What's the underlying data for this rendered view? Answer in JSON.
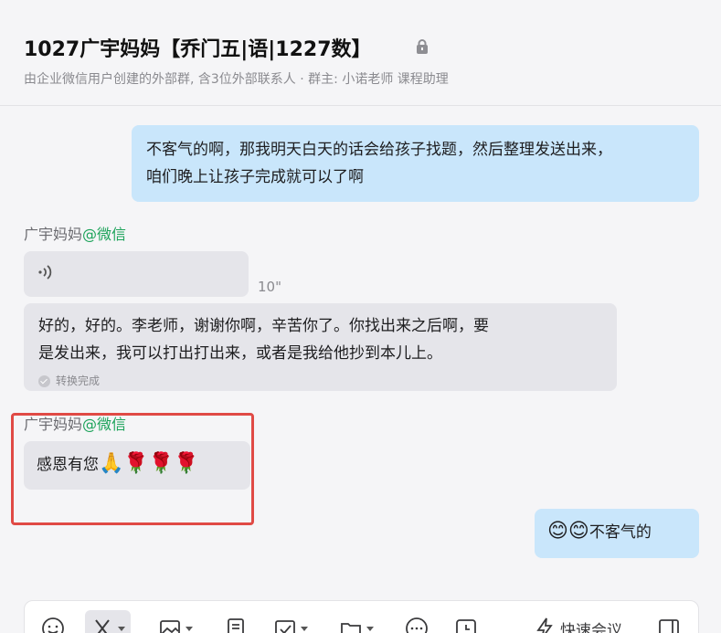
{
  "header": {
    "title": "1027广宇妈妈【乔门五|语|1227数】",
    "subtitle": "由企业微信用户创建的外部群, 含3位外部联系人 · 群主: 小诺老师 课程助理"
  },
  "messages": [
    {
      "side": "me",
      "text_line1": "不客气的啊，那我明天白天的话会给孩子找题，然后整理发送出来，",
      "text_line2": "咱们晚上让孩子完成就可以了啊"
    },
    {
      "side": "them",
      "sender_name": "广宇妈妈",
      "sender_source": "@微信",
      "type": "voice",
      "duration": "10\"",
      "transcript_line1": "好的，好的。李老师，谢谢你啊，辛苦你了。你找出来之后啊，要",
      "transcript_line2": "是发出来，我可以打出打出来，或者是我给他抄到本儿上。",
      "convert_status": "转换完成"
    },
    {
      "side": "them",
      "sender_name": "广宇妈妈",
      "sender_source": "@微信",
      "text": "感恩有您",
      "emojis": "🙏🌹🌹🌹"
    },
    {
      "side": "me",
      "emojis": "😊😊",
      "text": "不客气的"
    }
  ],
  "toolbar": {
    "items": [
      "emoji-icon",
      "scissors-icon",
      "image-icon",
      "document-icon",
      "calendar-check-icon",
      "folder-icon",
      "chat-bubble-icon",
      "clock-icon",
      "lightning-icon",
      "sidebar-icon"
    ],
    "quick_meeting_label": "快速会议"
  },
  "colors": {
    "my_bubble": "#c9e6fb",
    "their_bubble": "#e5e5ea",
    "source_green": "#1ca35a",
    "highlight_red": "#e04a45"
  }
}
